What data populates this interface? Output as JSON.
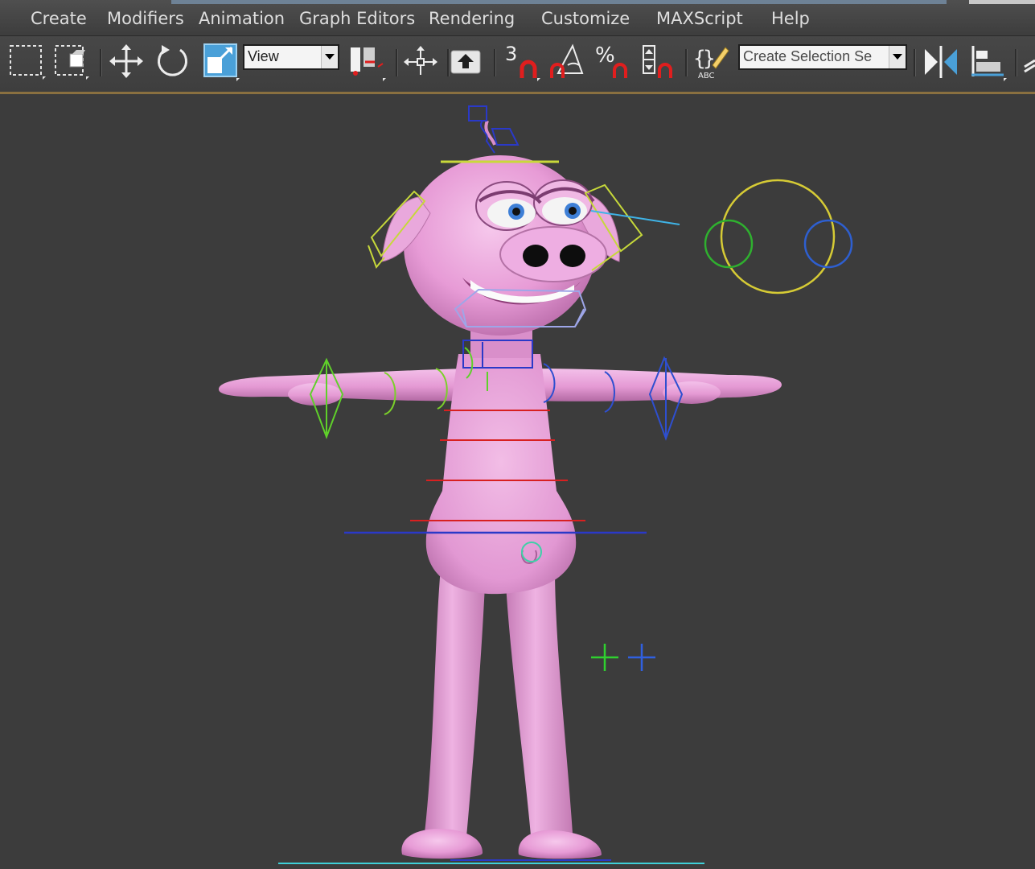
{
  "menu": {
    "items": [
      "Create",
      "Modifiers",
      "Animation",
      "Graph Editors",
      "Rendering",
      "Customize",
      "MAXScript",
      "Help"
    ]
  },
  "toolbar": {
    "reference_coord_value": "View",
    "snap_3d_label": "3",
    "percent_snap_label": "%",
    "named_selection_placeholder": "Create Selection Se",
    "abc_label": "ABC"
  },
  "colors": {
    "viewport_bg": "#3c3c3c",
    "character_pink": "#e79bd6",
    "accent_border": "#8a7040"
  }
}
